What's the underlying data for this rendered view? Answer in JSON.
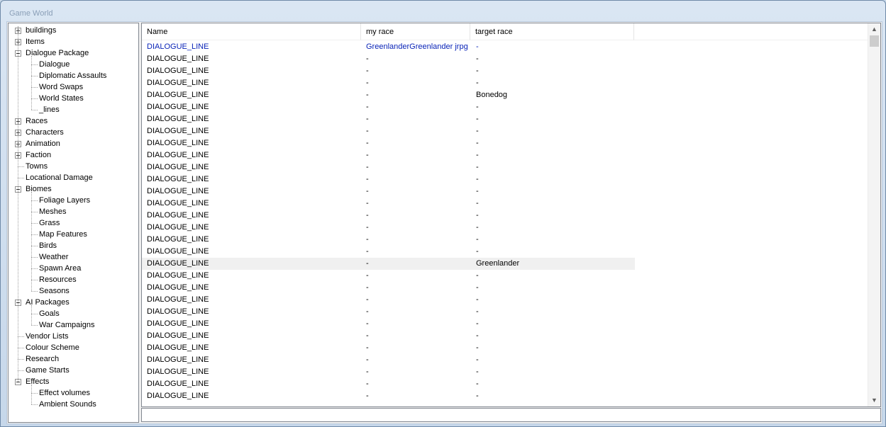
{
  "window": {
    "title": "Game World"
  },
  "tree": {
    "items": [
      {
        "label": "buildings",
        "level": 0,
        "expander": "plus"
      },
      {
        "label": "Items",
        "level": 0,
        "expander": "plus"
      },
      {
        "label": "Dialogue Package",
        "level": 0,
        "expander": "minus"
      },
      {
        "label": "Dialogue",
        "level": 1
      },
      {
        "label": "Diplomatic Assaults",
        "level": 1
      },
      {
        "label": "Word Swaps",
        "level": 1
      },
      {
        "label": "World States",
        "level": 1
      },
      {
        "label": "_lines",
        "level": 1
      },
      {
        "label": "Races",
        "level": 0,
        "expander": "plus"
      },
      {
        "label": "Characters",
        "level": 0,
        "expander": "plus"
      },
      {
        "label": "Animation",
        "level": 0,
        "expander": "plus"
      },
      {
        "label": "Faction",
        "level": 0,
        "expander": "plus"
      },
      {
        "label": "Towns",
        "level": 0
      },
      {
        "label": "Locational Damage",
        "level": 0
      },
      {
        "label": "Biomes",
        "level": 0,
        "expander": "minus"
      },
      {
        "label": "Foliage Layers",
        "level": 1
      },
      {
        "label": "Meshes",
        "level": 1
      },
      {
        "label": "Grass",
        "level": 1
      },
      {
        "label": "Map Features",
        "level": 1
      },
      {
        "label": "Birds",
        "level": 1
      },
      {
        "label": "Weather",
        "level": 1
      },
      {
        "label": "Spawn Area",
        "level": 1
      },
      {
        "label": "Resources",
        "level": 1
      },
      {
        "label": "Seasons",
        "level": 1
      },
      {
        "label": "AI Packages",
        "level": 0,
        "expander": "minus"
      },
      {
        "label": "Goals",
        "level": 1
      },
      {
        "label": "War Campaigns",
        "level": 1
      },
      {
        "label": "Vendor Lists",
        "level": 0
      },
      {
        "label": "Colour Scheme",
        "level": 0
      },
      {
        "label": "Research",
        "level": 0
      },
      {
        "label": "Game Starts",
        "level": 0
      },
      {
        "label": "Effects",
        "level": 0,
        "expander": "minus"
      },
      {
        "label": "Effect volumes",
        "level": 1
      },
      {
        "label": "Ambient Sounds",
        "level": 1
      }
    ]
  },
  "list": {
    "columns": [
      "Name",
      "my race",
      "target race"
    ],
    "rows": [
      [
        "DIALOGUE_LINE",
        "GreenlanderGreenlander jrpg",
        "-"
      ],
      [
        "DIALOGUE_LINE",
        "-",
        "-"
      ],
      [
        "DIALOGUE_LINE",
        "-",
        "-"
      ],
      [
        "DIALOGUE_LINE",
        "-",
        "-"
      ],
      [
        "DIALOGUE_LINE",
        "-",
        "Bonedog"
      ],
      [
        "DIALOGUE_LINE",
        "-",
        "-"
      ],
      [
        "DIALOGUE_LINE",
        "-",
        "-"
      ],
      [
        "DIALOGUE_LINE",
        "-",
        "-"
      ],
      [
        "DIALOGUE_LINE",
        "-",
        "-"
      ],
      [
        "DIALOGUE_LINE",
        "-",
        "-"
      ],
      [
        "DIALOGUE_LINE",
        "-",
        "-"
      ],
      [
        "DIALOGUE_LINE",
        "-",
        "-"
      ],
      [
        "DIALOGUE_LINE",
        "-",
        "-"
      ],
      [
        "DIALOGUE_LINE",
        "-",
        "-"
      ],
      [
        "DIALOGUE_LINE",
        "-",
        "-"
      ],
      [
        "DIALOGUE_LINE",
        "-",
        "-"
      ],
      [
        "DIALOGUE_LINE",
        "-",
        "-"
      ],
      [
        "DIALOGUE_LINE",
        "-",
        "-"
      ],
      [
        "DIALOGUE_LINE",
        "-",
        "Greenlander"
      ],
      [
        "DIALOGUE_LINE",
        "-",
        "-"
      ],
      [
        "DIALOGUE_LINE",
        "-",
        "-"
      ],
      [
        "DIALOGUE_LINE",
        "-",
        "-"
      ],
      [
        "DIALOGUE_LINE",
        "-",
        "-"
      ],
      [
        "DIALOGUE_LINE",
        "-",
        "-"
      ],
      [
        "DIALOGUE_LINE",
        "-",
        "-"
      ],
      [
        "DIALOGUE_LINE",
        "-",
        "-"
      ],
      [
        "DIALOGUE_LINE",
        "-",
        "-"
      ],
      [
        "DIALOGUE_LINE",
        "-",
        "-"
      ],
      [
        "DIALOGUE_LINE",
        "-",
        "-"
      ],
      [
        "DIALOGUE_LINE",
        "-",
        "-"
      ]
    ],
    "selected_row": 18,
    "link_color": "#0a24b8"
  },
  "scrollbar": {
    "up_icon": "scroll-up-arrow-icon",
    "down_icon": "scroll-down-arrow-icon"
  }
}
